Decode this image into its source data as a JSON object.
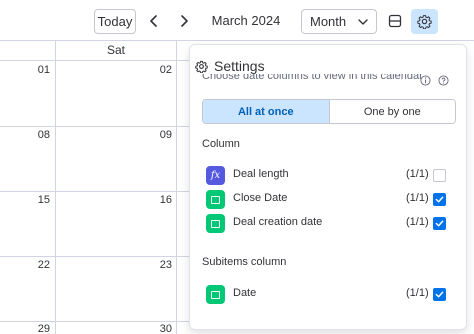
{
  "toolbar": {
    "today_label": "Today",
    "prev_icon": "chevron-left-icon",
    "next_icon": "chevron-right-icon",
    "month_title": "March 2024",
    "view_select": {
      "selected": "Month",
      "icon": "chevron-down-icon"
    },
    "layout_icon": "layout-split-icon",
    "settings_icon": "gear-icon"
  },
  "calendar": {
    "column_header": "Sat",
    "rows": [
      {
        "friday": "01",
        "saturday": "02"
      },
      {
        "friday": "08",
        "saturday": "09"
      },
      {
        "friday": "15",
        "saturday": "16"
      },
      {
        "friday": "22",
        "saturday": "23"
      },
      {
        "friday": "29",
        "saturday": "30"
      }
    ]
  },
  "settings_panel": {
    "title": "Settings",
    "title_icon": "gear-icon",
    "subtitle": "Choose date columns to view in this calendar",
    "info_icon": "info-icon",
    "help_icon": "help-icon",
    "mode_options": [
      {
        "label": "All at once",
        "active": true
      },
      {
        "label": "One by one",
        "active": false
      }
    ],
    "columns_section_label": "Column",
    "columns": [
      {
        "name": "Deal length",
        "count": "(1/1)",
        "checked": false,
        "icon": "formula-icon",
        "icon_glyph": "fx"
      },
      {
        "name": "Close Date",
        "count": "(1/1)",
        "checked": true,
        "icon": "date-column-icon"
      },
      {
        "name": "Deal creation date",
        "count": "(1/1)",
        "checked": true,
        "icon": "date-column-icon"
      }
    ],
    "subitems_section_label": "Subitems column",
    "subitems_columns": [
      {
        "name": "Date",
        "count": "(1/1)",
        "checked": true,
        "icon": "date-column-icon"
      }
    ]
  },
  "colors": {
    "accent": "#0073ea",
    "selected_bg": "#cce5ff",
    "selected_text": "#0060b9",
    "formula_icon": "#5559df",
    "date_icon": "#00c875",
    "grid_line": "#d0d4e4"
  }
}
